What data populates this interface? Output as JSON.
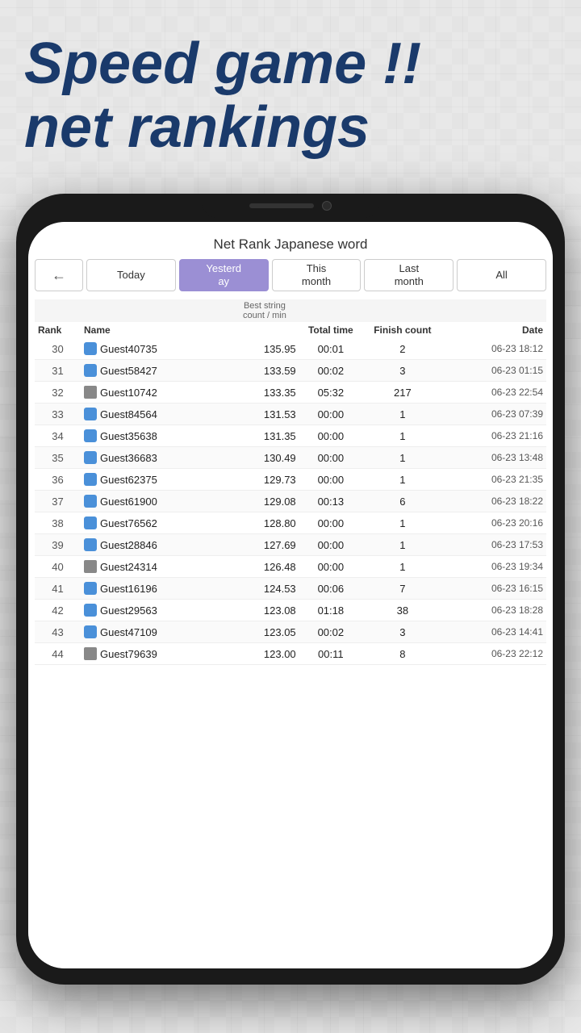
{
  "page": {
    "title_line1": "Speed game !!",
    "title_line2": "net rankings",
    "subtitle": "Net Rank Japanese word"
  },
  "tabs": {
    "back_label": "←",
    "items": [
      {
        "id": "today",
        "label": "Today",
        "active": false
      },
      {
        "id": "yesterday",
        "label": "Yesterd ay",
        "active": true
      },
      {
        "id": "this_month",
        "label": "This month",
        "active": false
      },
      {
        "id": "last_month",
        "label": "Last month",
        "active": false
      },
      {
        "id": "all",
        "label": "All",
        "active": false
      }
    ]
  },
  "table": {
    "columns": {
      "rank": "Rank",
      "name": "Name",
      "best_string": "Best string count / min",
      "total_time": "Total time",
      "finish_count": "Finish count",
      "date": "Date"
    },
    "rows": [
      {
        "rank": 30,
        "name": "Guest40735",
        "device": "phone",
        "score": "135.95",
        "total_time": "00:01",
        "finish_count": 2,
        "date": "06-23 18:12"
      },
      {
        "rank": 31,
        "name": "Guest58427",
        "device": "phone",
        "score": "133.59",
        "total_time": "00:02",
        "finish_count": 3,
        "date": "06-23 01:15"
      },
      {
        "rank": 32,
        "name": "Guest10742",
        "device": "tablet",
        "score": "133.35",
        "total_time": "05:32",
        "finish_count": 217,
        "date": "06-23 22:54"
      },
      {
        "rank": 33,
        "name": "Guest84564",
        "device": "phone",
        "score": "131.53",
        "total_time": "00:00",
        "finish_count": 1,
        "date": "06-23 07:39"
      },
      {
        "rank": 34,
        "name": "Guest35638",
        "device": "phone",
        "score": "131.35",
        "total_time": "00:00",
        "finish_count": 1,
        "date": "06-23 21:16"
      },
      {
        "rank": 35,
        "name": "Guest36683",
        "device": "phone",
        "score": "130.49",
        "total_time": "00:00",
        "finish_count": 1,
        "date": "06-23 13:48"
      },
      {
        "rank": 36,
        "name": "Guest62375",
        "device": "phone",
        "score": "129.73",
        "total_time": "00:00",
        "finish_count": 1,
        "date": "06-23 21:35"
      },
      {
        "rank": 37,
        "name": "Guest61900",
        "device": "phone",
        "score": "129.08",
        "total_time": "00:13",
        "finish_count": 6,
        "date": "06-23 18:22"
      },
      {
        "rank": 38,
        "name": "Guest76562",
        "device": "phone",
        "score": "128.80",
        "total_time": "00:00",
        "finish_count": 1,
        "date": "06-23 20:16"
      },
      {
        "rank": 39,
        "name": "Guest28846",
        "device": "phone",
        "score": "127.69",
        "total_time": "00:00",
        "finish_count": 1,
        "date": "06-23 17:53"
      },
      {
        "rank": 40,
        "name": "Guest24314",
        "device": "tablet",
        "score": "126.48",
        "total_time": "00:00",
        "finish_count": 1,
        "date": "06-23 19:34"
      },
      {
        "rank": 41,
        "name": "Guest16196",
        "device": "phone",
        "score": "124.53",
        "total_time": "00:06",
        "finish_count": 7,
        "date": "06-23 16:15"
      },
      {
        "rank": 42,
        "name": "Guest29563",
        "device": "phone",
        "score": "123.08",
        "total_time": "01:18",
        "finish_count": 38,
        "date": "06-23 18:28"
      },
      {
        "rank": 43,
        "name": "Guest47109",
        "device": "phone",
        "score": "123.05",
        "total_time": "00:02",
        "finish_count": 3,
        "date": "06-23 14:41"
      },
      {
        "rank": 44,
        "name": "Guest79639",
        "device": "tablet",
        "score": "123.00",
        "total_time": "00:11",
        "finish_count": 8,
        "date": "06-23 22:12"
      }
    ]
  }
}
